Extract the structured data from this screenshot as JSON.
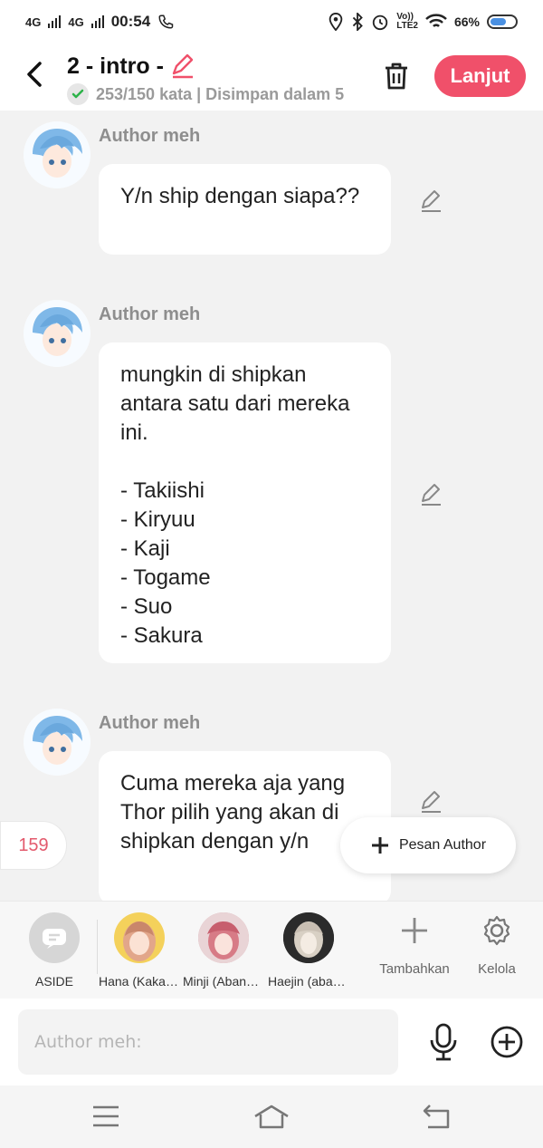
{
  "status_bar": {
    "net1": "4G",
    "net2": "4G",
    "time": "00:54",
    "volte": "Vo))\nLTE2",
    "battery_text": "66%",
    "battery_level": 0.66
  },
  "header": {
    "title": "2 - intro -",
    "subtitle": "253/150 kata | Disimpan dalam 5",
    "next_label": "Lanjut"
  },
  "messages": [
    {
      "author": "Author meh",
      "text": "Y/n ship dengan siapa??"
    },
    {
      "author": "Author meh",
      "text": "mungkin di shipkan antara satu dari mereka ini.\n\n- Takiishi\n- Kiryuu\n- Kaji\n- Togame\n- Suo\n- Sakura"
    },
    {
      "author": "Author meh",
      "text": "Cuma mereka aja yang Thor pilih yang akan di shipkan dengan y/n"
    }
  ],
  "word_count_badge": "159",
  "pesan_author_label": "Pesan Author",
  "characters": [
    {
      "label": "ASIDE",
      "color": "#d6d6d6"
    },
    {
      "label": "Hana (Kakak y/n)",
      "color": "#f4d15b"
    },
    {
      "label": "Minji (Abang y/n)",
      "color": "#d9a3a8"
    },
    {
      "label": "Haejin (abang y/n)",
      "color": "#2b2b2b"
    }
  ],
  "tools": {
    "add_label": "Tambahkan",
    "manage_label": "Kelola"
  },
  "input": {
    "placeholder": "Author meh:"
  },
  "colors": {
    "accent": "#f0506a",
    "badge_text": "#e35a6d"
  }
}
